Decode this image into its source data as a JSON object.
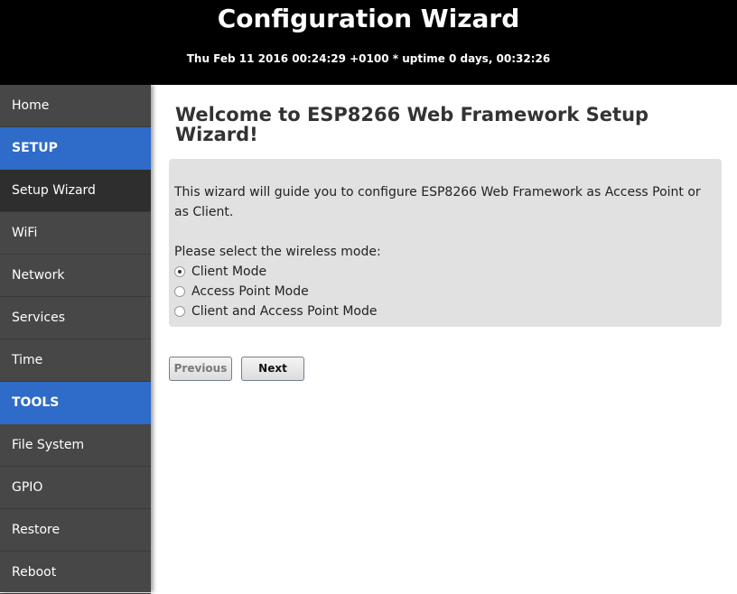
{
  "header": {
    "title": "Configuration Wizard",
    "status": "Thu Feb 11 2016 00:24:29 +0100 * uptime 0 days, 00:32:26"
  },
  "sidebar": {
    "items": [
      {
        "label": "Home",
        "type": "item"
      },
      {
        "label": "SETUP",
        "type": "section"
      },
      {
        "label": "Setup Wizard",
        "type": "item",
        "active": true
      },
      {
        "label": "WiFi",
        "type": "item"
      },
      {
        "label": "Network",
        "type": "item"
      },
      {
        "label": "Services",
        "type": "item"
      },
      {
        "label": "Time",
        "type": "item"
      },
      {
        "label": "TOOLS",
        "type": "section"
      },
      {
        "label": "File System",
        "type": "item"
      },
      {
        "label": "GPIO",
        "type": "item"
      },
      {
        "label": "Restore",
        "type": "item"
      },
      {
        "label": "Reboot",
        "type": "item"
      }
    ]
  },
  "main": {
    "title": "Welcome to ESP8266 Web Framework Setup Wizard!",
    "intro": "This wizard will guide you to configure ESP8266 Web Framework as Access Point or as Client.",
    "prompt": "Please select the wireless mode:",
    "options": [
      {
        "label": "Client Mode",
        "checked": true
      },
      {
        "label": "Access Point Mode",
        "checked": false
      },
      {
        "label": "Client and Access Point Mode",
        "checked": false
      }
    ],
    "buttons": {
      "previous": "Previous",
      "next": "Next"
    }
  },
  "colors": {
    "header_bg": "#000000",
    "sidebar_bg": "#474747",
    "section_bg": "#2f6bc8",
    "active_bg": "#2e2e2e",
    "panel_bg": "#e1e1e1"
  }
}
